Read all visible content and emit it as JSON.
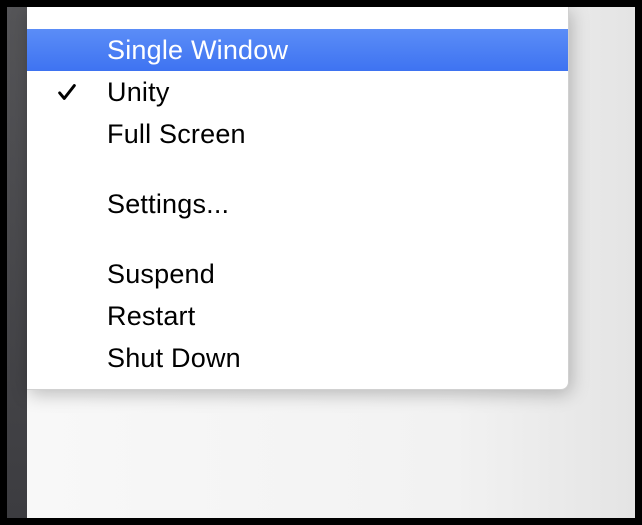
{
  "menu": {
    "groups": [
      {
        "items": [
          {
            "id": "single-window",
            "label": "Single Window",
            "checked": false,
            "highlighted": true
          },
          {
            "id": "unity",
            "label": "Unity",
            "checked": true,
            "highlighted": false
          },
          {
            "id": "full-screen",
            "label": "Full Screen",
            "checked": false,
            "highlighted": false
          }
        ]
      },
      {
        "items": [
          {
            "id": "settings",
            "label": "Settings...",
            "checked": false,
            "highlighted": false
          }
        ]
      },
      {
        "items": [
          {
            "id": "suspend",
            "label": "Suspend",
            "checked": false,
            "highlighted": false
          },
          {
            "id": "restart",
            "label": "Restart",
            "checked": false,
            "highlighted": false
          },
          {
            "id": "shut-down",
            "label": "Shut Down",
            "checked": false,
            "highlighted": false
          }
        ]
      }
    ]
  },
  "colors": {
    "highlight_top": "#5b8df7",
    "highlight_bottom": "#3e73f1"
  }
}
